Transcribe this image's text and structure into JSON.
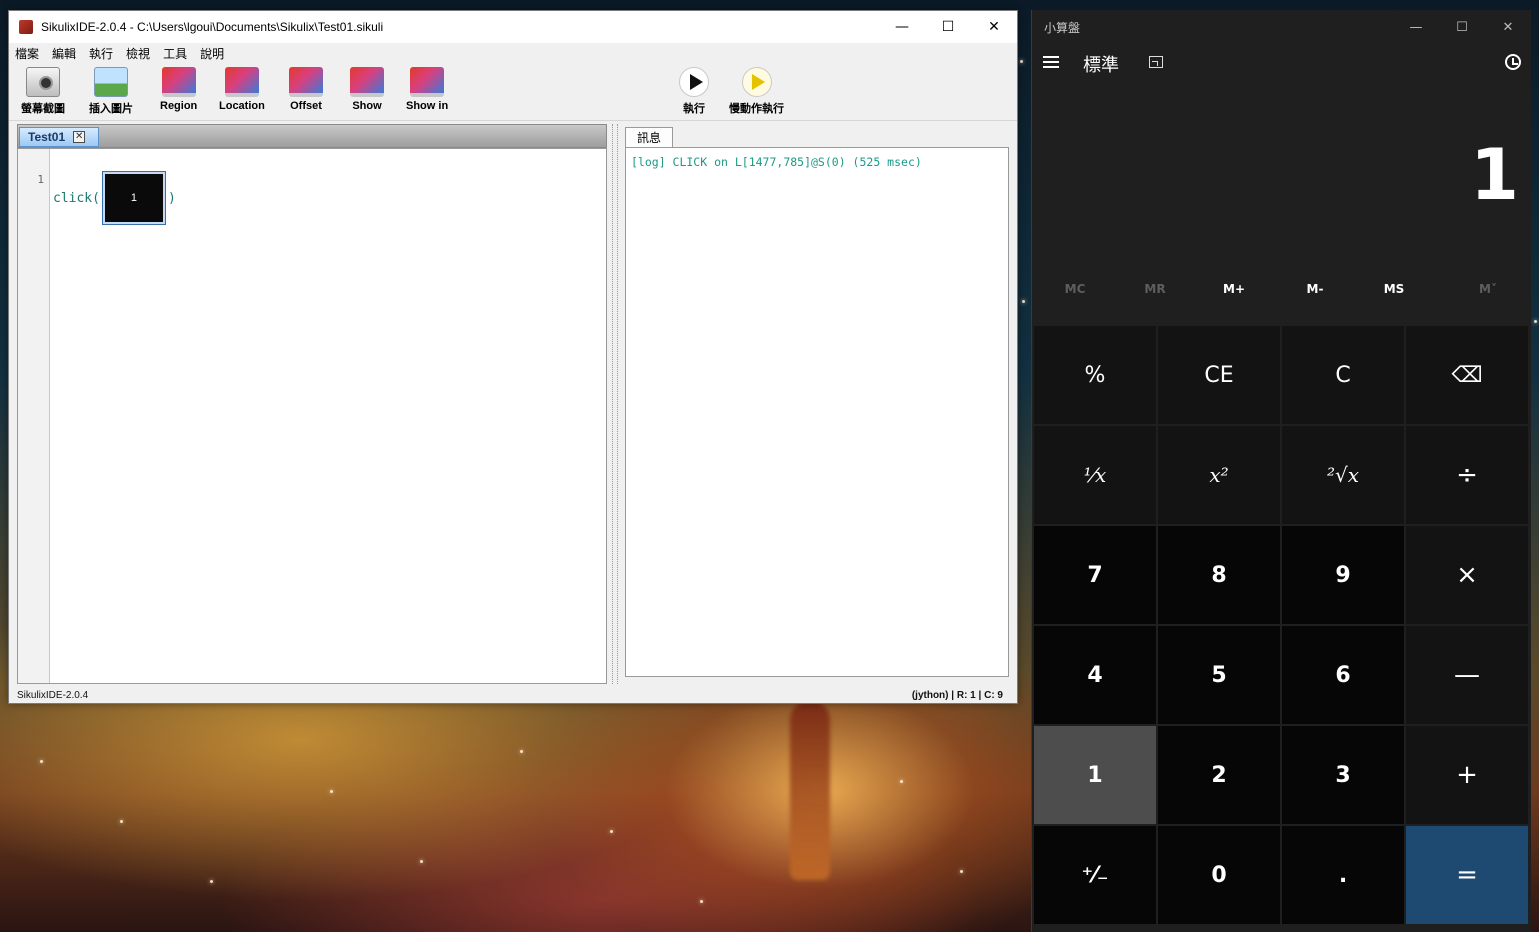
{
  "sikulix": {
    "title": "SikulixIDE-2.0.4 - C:\\Users\\lgoui\\Documents\\Sikulix\\Test01.sikuli",
    "menu": [
      "檔案",
      "編輯",
      "執行",
      "檢視",
      "工具",
      "說明"
    ],
    "toolbar": {
      "capture": "螢幕截圖",
      "insert_image": "插入圖片",
      "region": "Region",
      "location": "Location",
      "offset": "Offset",
      "show": "Show",
      "show_in": "Show in",
      "run": "執行",
      "run_slow": "慢動作執行"
    },
    "editor": {
      "tab_label": "Test01",
      "line_number": "1",
      "code_prefix": "click(",
      "image_label": "1",
      "code_suffix": ")"
    },
    "messages": {
      "tab_label": "訊息",
      "log": "[log] CLICK on L[1477,785]@S(0) (525 msec)"
    },
    "status": {
      "left": "SikulixIDE-2.0.4",
      "right": "(jython) | R: 1 | C: 9"
    }
  },
  "calculator": {
    "title": "小算盤",
    "mode": "標準",
    "display": "1",
    "memory": {
      "mc": "MC",
      "mr": "MR",
      "mplus": "M+",
      "mminus": "M-",
      "ms": "MS",
      "mlist": "M˅"
    },
    "keys": {
      "percent": "%",
      "ce": "CE",
      "clear": "C",
      "backspace": "⌫",
      "reciprocal": "¹⁄x",
      "square": "x²",
      "sqrt": "²√x",
      "divide": "÷",
      "seven": "7",
      "eight": "8",
      "nine": "9",
      "multiply": "×",
      "four": "4",
      "five": "5",
      "six": "6",
      "minus": "—",
      "one": "1",
      "two": "2",
      "three": "3",
      "plus": "+",
      "negate": "⁺⁄₋",
      "zero": "0",
      "decimal": ".",
      "equals": "="
    }
  }
}
